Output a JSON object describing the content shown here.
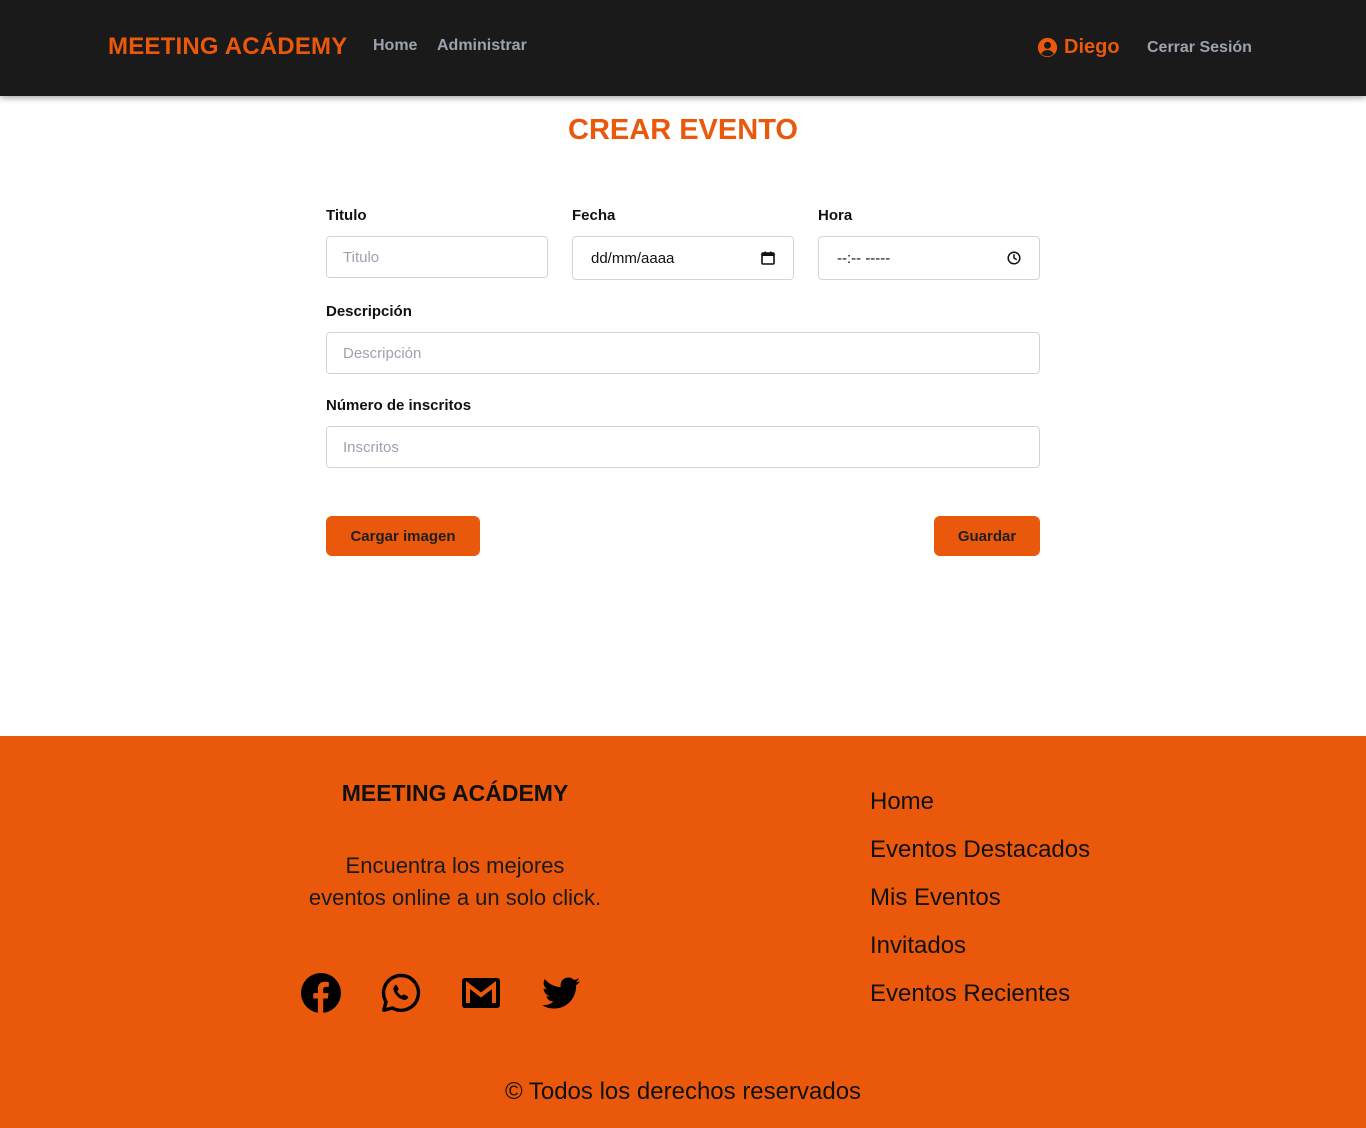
{
  "navbar": {
    "brand": "MEETING ACÁDEMY",
    "links": [
      "Home",
      "Administrar"
    ],
    "user_name": "Diego",
    "logout": "Cerrar Sesión"
  },
  "form": {
    "title": "CREAR EVENTO",
    "titulo": {
      "label": "Titulo",
      "placeholder": "Titulo",
      "value": ""
    },
    "fecha": {
      "label": "Fecha",
      "display": "dd/mm/aaaa"
    },
    "hora": {
      "label": "Hora",
      "display": "--:-- -----"
    },
    "descripcion": {
      "label": "Descripción",
      "placeholder": "Descripción",
      "value": ""
    },
    "inscritos": {
      "label": "Número de inscritos",
      "placeholder": "Inscritos",
      "value": ""
    },
    "upload_button": "Cargar imagen",
    "save_button": "Guardar"
  },
  "footer": {
    "brand": "MEETING ACÁDEMY",
    "tagline_line1": "Encuentra los mejores",
    "tagline_line2": "eventos online a un solo click.",
    "social_icons": [
      "facebook-icon",
      "whatsapp-icon",
      "gmail-icon",
      "twitter-icon"
    ],
    "links": [
      "Home",
      "Eventos Destacados",
      "Mis Eventos",
      "Invitados",
      "Eventos Recientes"
    ],
    "copyright": "© Todos los derechos reservados"
  },
  "colors": {
    "accent": "#ea580c",
    "navbar_bg": "#1a1a1b",
    "nav_link": "#9ca3af"
  }
}
